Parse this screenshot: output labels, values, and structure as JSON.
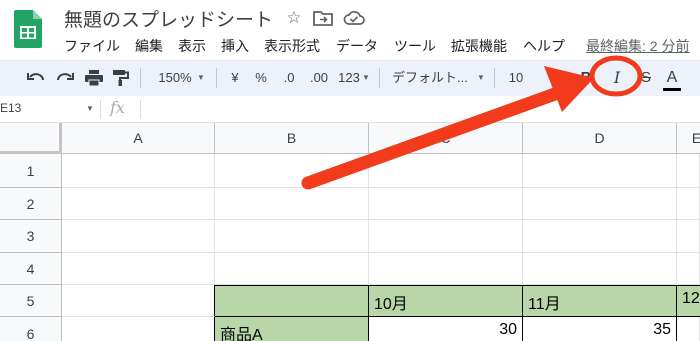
{
  "doc": {
    "title": "無題のスプレッドシート",
    "last_edit": "最終編集: 2 分前"
  },
  "icons": [
    "sheets-logo-icon",
    "star-icon",
    "move-to-folder-icon",
    "cloud-saved-icon",
    "undo-icon",
    "redo-icon",
    "print-icon",
    "paint-format-icon",
    "bold-icon",
    "italic-icon",
    "strikethrough-icon",
    "text-color-icon"
  ],
  "menu": [
    "ファイル",
    "編集",
    "表示",
    "挿入",
    "表示形式",
    "データ",
    "ツール",
    "拡張機能",
    "ヘルプ"
  ],
  "toolbar": {
    "zoom": "150%",
    "currency": "¥",
    "percent": "%",
    "decrease_decimal": ".0",
    "increase_decimal": ".00",
    "more_formats": "123",
    "font": "デフォルト...",
    "font_size": "10",
    "bold": "B",
    "italic": "I",
    "strike": "S",
    "text_color": "A"
  },
  "formula_bar": {
    "cell_ref": "E13",
    "fx": "fx"
  },
  "grid": {
    "columns": [
      "A",
      "B",
      "C",
      "D",
      "E"
    ],
    "rows": [
      "1",
      "2",
      "3",
      "4",
      "5",
      "6"
    ],
    "cells": {
      "C5": "10月",
      "D5": "11月",
      "E5": "12",
      "B6": "商品A",
      "C6": "30",
      "D6": "35"
    }
  },
  "annotation": {
    "arrow_color": "#f23a1c"
  }
}
